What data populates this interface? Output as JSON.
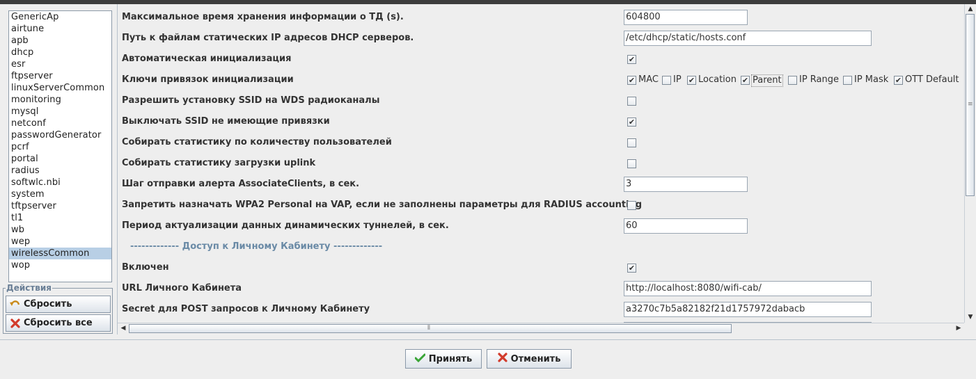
{
  "modules": {
    "items": [
      "GenericAp",
      "airtune",
      "apb",
      "dhcp",
      "esr",
      "ftpserver",
      "linuxServerCommon",
      "monitoring",
      "mysql",
      "netconf",
      "passwordGenerator",
      "pcrf",
      "portal",
      "radius",
      "softwlc.nbi",
      "system",
      "tftpserver",
      "tl1",
      "wb",
      "wep",
      "wirelessCommon",
      "wop"
    ],
    "selected": "wirelessCommon"
  },
  "actions": {
    "title": "Действия",
    "reset_label": "Сбросить",
    "reset_all_label": "Сбросить все"
  },
  "settings": {
    "max_info_time": {
      "label": "Максимальное время хранения информации о ТД (s).",
      "value": "604800"
    },
    "dhcp_static_path": {
      "label": "Путь к файлам статических IP адресов DHCP серверов.",
      "value": "/etc/dhcp/static/hosts.conf"
    },
    "auto_init": {
      "label": "Автоматическая инициализация",
      "checked": true
    },
    "init_keys": {
      "label": "Ключи привязок инициализации",
      "options": [
        {
          "label": "MAC",
          "checked": true
        },
        {
          "label": "IP",
          "checked": false
        },
        {
          "label": "Location",
          "checked": true
        },
        {
          "label": "Parent",
          "checked": true
        },
        {
          "label": "IP Range",
          "checked": false
        },
        {
          "label": "IP Mask",
          "checked": false
        },
        {
          "label": "OTT Default",
          "checked": true
        }
      ]
    },
    "ssid_wds": {
      "label": "Разрешить установку SSID на WDS радиоканалы",
      "checked": false
    },
    "disable_ssid": {
      "label": "Выключать SSID не имеющие привязки",
      "checked": true
    },
    "stats_users": {
      "label": "Собирать статистику по количеству пользователей",
      "checked": false
    },
    "stats_uplink": {
      "label": "Собирать статистику загрузки uplink",
      "checked": false
    },
    "alert_step": {
      "label": "Шаг отправки алерта AssociateClients, в сек.",
      "value": "3"
    },
    "wpa2_forbid": {
      "label": "Запретить назначать WPA2 Personal на VAP, если не заполнены параметры для RADIUS accounting",
      "checked": false
    },
    "tunnel_period": {
      "label": "Период актуализации данных динамических туннелей, в сек.",
      "value": "60"
    },
    "section_cabinet": "------------- Доступ к Личному Кабинету -------------",
    "cabinet_enabled": {
      "label": "Включен",
      "checked": true
    },
    "cabinet_url": {
      "label": "URL Личного Кабинета",
      "value": "http://localhost:8080/wifi-cab/"
    },
    "cabinet_secret": {
      "label": "Secret для POST запросов к Личному Кабинету",
      "value": "a3270c7b5a82182f21d1757972dabacb"
    }
  },
  "dialog": {
    "accept_label": "Принять",
    "cancel_label": "Отменить"
  },
  "colors": {
    "selected": "#b8cfe5",
    "section": "#6a8aa6",
    "accept_icon": "#3aa536",
    "cancel_icon": "#d23a2a"
  }
}
